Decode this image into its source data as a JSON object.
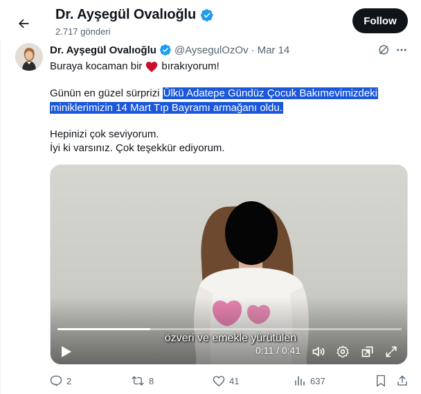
{
  "header": {
    "title": "Dr. Ayşegül Ovalıoğlu",
    "post_count": "2.717 gönderi",
    "follow_label": "Follow",
    "back_icon": "arrow-left-icon"
  },
  "tweet": {
    "author_name": "Dr. Ayşegül Ovalıoğlu",
    "handle": "@AysegulOzOv",
    "separator": "·",
    "date": "Mar 14",
    "line1_before": "Buraya kocaman bir",
    "line1_after": "bırakıyorum!",
    "line2_plain": "Günün en güzel sürprizi",
    "line2_highlight": "Ülkü Adatepe Gündüz Çocuk Bakımevimizdeki",
    "line3_highlight": "miniklerimizin 14 Mart Tıp Bayramı armağanı oldu.",
    "line4": "Hepinizi çok seviyorum.",
    "line5": "İyi ki varsınız. Çok teşekkür ediyorum."
  },
  "video": {
    "subtitle": "özveri ve emekle yürütülen",
    "time": "0:11 / 0:41",
    "progress": 0.27
  },
  "actions": {
    "replies": "2",
    "reposts": "8",
    "likes": "41",
    "views": "637"
  },
  "colors": {
    "accent": "#1d9bf0",
    "highlight": "#1a57d9",
    "heart": "#c8102e",
    "text": "#0f1419",
    "muted": "#536471"
  }
}
